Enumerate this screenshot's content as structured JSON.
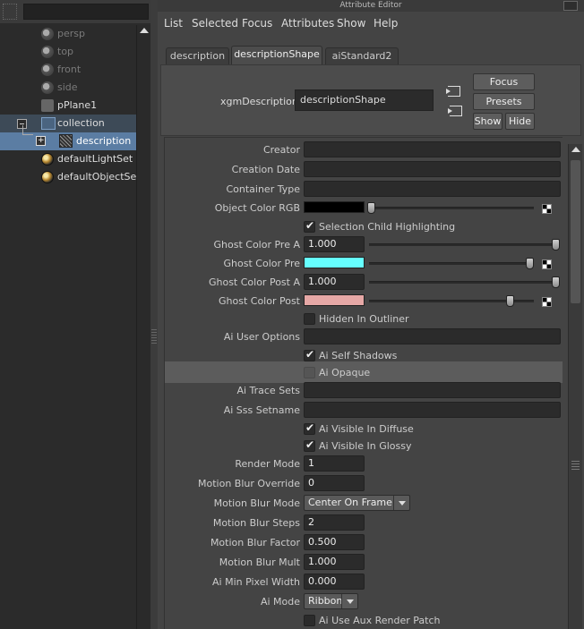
{
  "outliner": {
    "nodes": [
      {
        "label": "persp",
        "icon": "camera-icon",
        "dim": true
      },
      {
        "label": "top",
        "icon": "camera-icon",
        "dim": true
      },
      {
        "label": "front",
        "icon": "camera-icon",
        "dim": true
      },
      {
        "label": "side",
        "icon": "camera-icon",
        "dim": true
      },
      {
        "label": "pPlane1",
        "icon": "mesh-icon",
        "dim": false
      },
      {
        "label": "collection",
        "icon": "collection-icon",
        "dim": false
      },
      {
        "label": "description",
        "icon": "description-icon",
        "dim": false,
        "selected": true
      },
      {
        "label": "defaultLightSet",
        "icon": "set-icon",
        "dim": false
      },
      {
        "label": "defaultObjectSet",
        "icon": "set-icon",
        "dim": false
      }
    ]
  },
  "attribute_editor": {
    "title": "Attribute Editor",
    "menu": [
      "List",
      "Selected",
      "Focus",
      "Attributes",
      "Show",
      "Help"
    ],
    "tabs": [
      "description",
      "descriptionShape",
      "aiStandard2"
    ],
    "active_tab": "descriptionShape",
    "node_type_label": "xgmDescription:",
    "node_name": "descriptionShape",
    "buttons": {
      "focus": "Focus",
      "presets": "Presets",
      "show": "Show",
      "hide": "Hide"
    }
  },
  "attributes": {
    "creator": {
      "label": "Creator",
      "value": ""
    },
    "creation_date": {
      "label": "Creation Date",
      "value": ""
    },
    "container_type": {
      "label": "Container Type",
      "value": ""
    },
    "object_color_rgb": {
      "label": "Object Color RGB",
      "color": "#000000",
      "slider": 0.0
    },
    "selection_child_highlighting": {
      "label": "Selection Child Highlighting",
      "checked": true
    },
    "ghost_color_pre_a": {
      "label": "Ghost Color Pre A",
      "value": "1.000",
      "slider": 1.0
    },
    "ghost_color_pre": {
      "label": "Ghost Color Pre",
      "color": "#66ffff",
      "slider": 0.9
    },
    "ghost_color_post_a": {
      "label": "Ghost Color Post A",
      "value": "1.000",
      "slider": 1.0
    },
    "ghost_color_post": {
      "label": "Ghost Color Post",
      "color": "#e6a8a6",
      "slider": 0.8
    },
    "hidden_in_outliner": {
      "label": "Hidden In Outliner",
      "checked": false
    },
    "ai_user_options": {
      "label": "Ai User Options",
      "value": ""
    },
    "ai_self_shadows": {
      "label": "Ai Self Shadows",
      "checked": true
    },
    "ai_opaque": {
      "label": "Ai Opaque",
      "checked": false
    },
    "ai_trace_sets": {
      "label": "Ai Trace Sets",
      "value": ""
    },
    "ai_sss_setname": {
      "label": "Ai Sss Setname",
      "value": ""
    },
    "ai_visible_in_diffuse": {
      "label": "Ai Visible In Diffuse",
      "checked": true
    },
    "ai_visible_in_glossy": {
      "label": "Ai Visible In Glossy",
      "checked": true
    },
    "render_mode": {
      "label": "Render Mode",
      "value": "1"
    },
    "motion_blur_override": {
      "label": "Motion Blur Override",
      "value": "0"
    },
    "motion_blur_mode": {
      "label": "Motion Blur Mode",
      "value": "Center On Frame"
    },
    "motion_blur_steps": {
      "label": "Motion Blur Steps",
      "value": "2"
    },
    "motion_blur_factor": {
      "label": "Motion Blur Factor",
      "value": "0.500"
    },
    "motion_blur_mult": {
      "label": "Motion Blur Mult",
      "value": "1.000"
    },
    "ai_min_pixel_width": {
      "label": "Ai Min Pixel Width",
      "value": "0.000"
    },
    "ai_mode": {
      "label": "Ai Mode",
      "value": "Ribbon"
    },
    "ai_use_aux_render_patch": {
      "label": "Ai Use Aux Render Patch",
      "checked": false
    }
  }
}
